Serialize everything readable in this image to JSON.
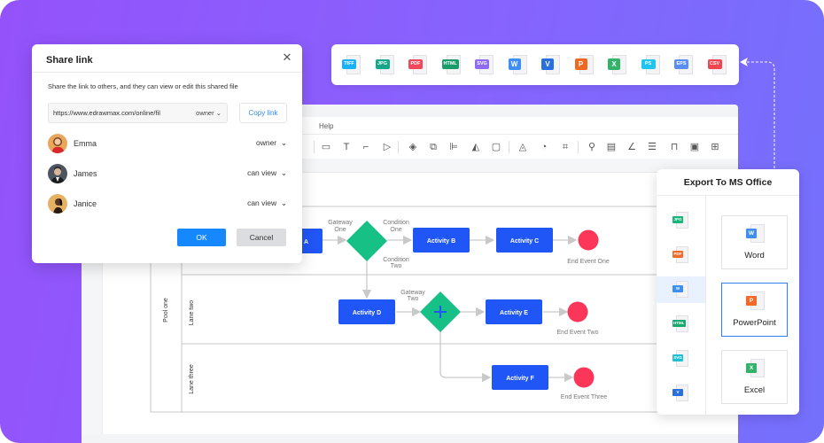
{
  "editor": {
    "menu_help": "Help",
    "toolbar_icons": [
      "rectangle-icon",
      "text-icon",
      "connector-icon",
      "pointer-icon",
      "layers-icon",
      "group-icon",
      "align-icon",
      "flip-icon",
      "frame-icon",
      "fill-color-icon",
      "shape-style-icon",
      "crop-icon",
      "search-icon",
      "format-painter-icon",
      "line-color-icon",
      "line-style-icon",
      "lock-icon",
      "fit-icon",
      "more-icon"
    ]
  },
  "diagram": {
    "pool_label": "Pool one",
    "lanes": [
      "",
      "Lane two",
      "Lane three"
    ],
    "activities": [
      {
        "id": "a",
        "label": "Activity A"
      },
      {
        "id": "b",
        "label": "Activity B"
      },
      {
        "id": "c",
        "label": "Activity C"
      },
      {
        "id": "d",
        "label": "Activity D"
      },
      {
        "id": "e",
        "label": "Activity E"
      },
      {
        "id": "f",
        "label": "Activity F"
      }
    ],
    "gateways": [
      {
        "id": "g1",
        "label_line1": "Gateway",
        "label_line2": "One"
      },
      {
        "id": "g2",
        "label_line1": "Gateway",
        "label_line2": "Two"
      }
    ],
    "conditions": [
      {
        "line1": "Condition",
        "line2": "One"
      },
      {
        "line1": "Condition",
        "line2": "Two"
      }
    ],
    "end_events": [
      "End Event One",
      "End Event Two",
      "End Event Three"
    ],
    "colors": {
      "activity": "#2156f6",
      "gateway": "#17c185",
      "end_event": "#fb3658",
      "connector": "#c9c9c9"
    }
  },
  "share_dialog": {
    "title": "Share link",
    "description": "Share the link to others, and they can view or edit this shared file",
    "link_url": "https://www.edrawmax.com/online/fil",
    "link_permission": "owner",
    "copy_label": "Copy link",
    "users": [
      {
        "name": "Emma",
        "role": "owner"
      },
      {
        "name": "James",
        "role": "can view"
      },
      {
        "name": "Janice",
        "role": "can view"
      }
    ],
    "ok_label": "OK",
    "cancel_label": "Cancel"
  },
  "export_formats": [
    {
      "label": "TIFF",
      "color": "#1ab2f5"
    },
    {
      "label": "JPG",
      "color": "#18a68a"
    },
    {
      "label": "PDF",
      "color": "#f2475b"
    },
    {
      "label": "HTML",
      "color": "#1a9b6a"
    },
    {
      "label": "SVG",
      "color": "#8e6cf2"
    },
    {
      "label": "W",
      "color": "#3d8ef5"
    },
    {
      "label": "V",
      "color": "#2a6fe0"
    },
    {
      "label": "P",
      "color": "#f0671f"
    },
    {
      "label": "X",
      "color": "#34b26a"
    },
    {
      "label": "PS",
      "color": "#1fc4f0"
    },
    {
      "label": "EPS",
      "color": "#5b8ef5"
    },
    {
      "label": "CSV",
      "color": "#f0454f"
    }
  ],
  "export_panel": {
    "title": "Export To MS Office",
    "side_formats": [
      {
        "label": "JPG",
        "color": "#18b57a"
      },
      {
        "label": "PDF",
        "color": "#f26a2a"
      },
      {
        "label": "W",
        "color": "#3d8ef5",
        "active": true
      },
      {
        "label": "HTML",
        "color": "#1aa86e"
      },
      {
        "label": "SVG",
        "color": "#1fc0d6"
      },
      {
        "label": "V",
        "color": "#2a6fe0"
      }
    ],
    "options": [
      {
        "label": "Word",
        "badge": "W",
        "color": "#3d8ef5"
      },
      {
        "label": "PowerPoint",
        "badge": "P",
        "color": "#f26a2a",
        "active": true
      },
      {
        "label": "Excel",
        "badge": "X",
        "color": "#34b26a"
      }
    ]
  }
}
